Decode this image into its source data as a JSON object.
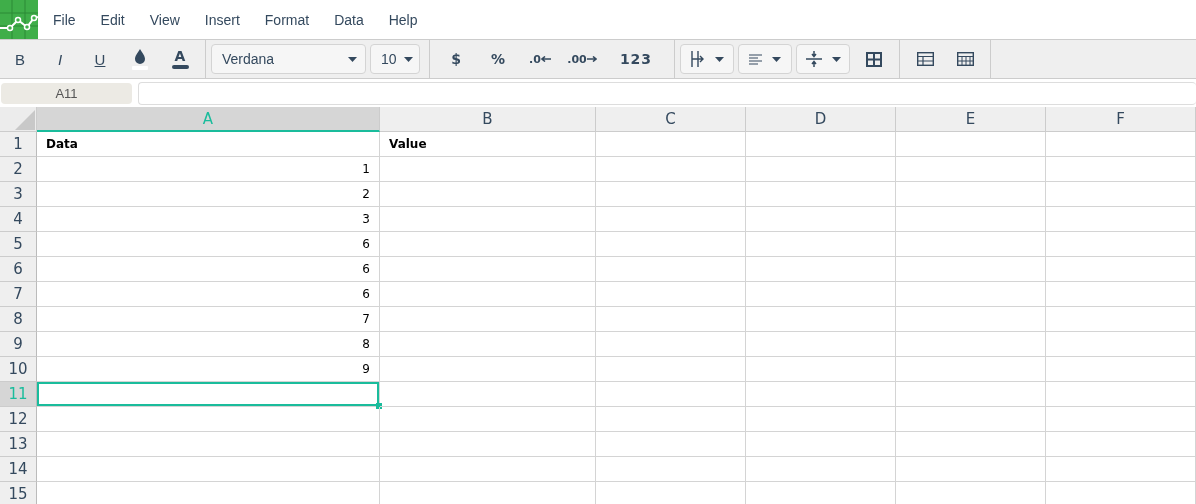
{
  "menu": [
    "File",
    "Edit",
    "View",
    "Insert",
    "Format",
    "Data",
    "Help"
  ],
  "toolbar": {
    "bold": "B",
    "italic": "I",
    "underline": "U",
    "text_color": "A",
    "font": "Verdana",
    "size": "10",
    "currency": "$",
    "percent": "%",
    "decrease_decimals": ".0",
    "increase_decimals": ".00",
    "number_format": "123"
  },
  "name_box": "A11",
  "columns": [
    {
      "label": "A",
      "selected": true
    },
    {
      "label": "B",
      "selected": false
    },
    {
      "label": "C",
      "selected": false
    },
    {
      "label": "D",
      "selected": false
    },
    {
      "label": "E",
      "selected": false
    },
    {
      "label": "F",
      "selected": false
    }
  ],
  "rows": [
    {
      "label": "1",
      "selected": false,
      "cells": [
        {
          "text": "Data",
          "kind": "header"
        },
        {
          "text": "Value",
          "kind": "header"
        }
      ]
    },
    {
      "label": "2",
      "selected": false,
      "cells": [
        {
          "text": "1",
          "kind": "number"
        }
      ]
    },
    {
      "label": "3",
      "selected": false,
      "cells": [
        {
          "text": "2",
          "kind": "number"
        }
      ]
    },
    {
      "label": "4",
      "selected": false,
      "cells": [
        {
          "text": "3",
          "kind": "number"
        }
      ]
    },
    {
      "label": "5",
      "selected": false,
      "cells": [
        {
          "text": "6",
          "kind": "number"
        }
      ]
    },
    {
      "label": "6",
      "selected": false,
      "cells": [
        {
          "text": "6",
          "kind": "number"
        }
      ]
    },
    {
      "label": "7",
      "selected": false,
      "cells": [
        {
          "text": "6",
          "kind": "number"
        }
      ]
    },
    {
      "label": "8",
      "selected": false,
      "cells": [
        {
          "text": "7",
          "kind": "number"
        }
      ]
    },
    {
      "label": "9",
      "selected": false,
      "cells": [
        {
          "text": "8",
          "kind": "number"
        }
      ]
    },
    {
      "label": "10",
      "selected": false,
      "cells": [
        {
          "text": "9",
          "kind": "number"
        }
      ]
    },
    {
      "label": "11",
      "selected": true
    },
    {
      "label": "12",
      "selected": false
    },
    {
      "label": "13",
      "selected": false
    },
    {
      "label": "14",
      "selected": false
    },
    {
      "label": "15",
      "selected": false
    }
  ]
}
